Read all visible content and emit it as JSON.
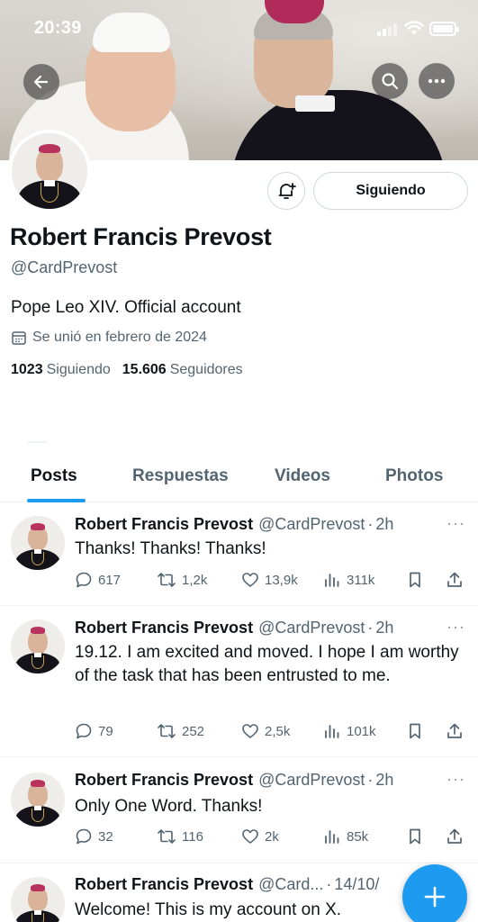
{
  "status_bar": {
    "time": "20:39"
  },
  "profile": {
    "display_name": "Robert Francis Prevost",
    "handle": "@CardPrevost",
    "bio": "Pope Leo XIV. Official account",
    "joined": "Se unió en febrero de 2024",
    "following_count": "1023",
    "following_label": "Siguiendo",
    "followers_count": "15.606",
    "followers_label": "Seguidores",
    "follow_button": "Siguiendo"
  },
  "tabs": [
    {
      "label": "Posts",
      "active": true
    },
    {
      "label": "Respuestas",
      "active": false
    },
    {
      "label": "Videos",
      "active": false
    },
    {
      "label": "Photos",
      "active": false
    }
  ],
  "posts": [
    {
      "name": "Robert Francis Prevost",
      "handle": "@CardPrevost",
      "separator": "·",
      "time": "2h",
      "text": "Thanks! Thanks! Thanks!",
      "replies": "617",
      "reposts": "1,2k",
      "likes": "13,9k",
      "views": "311k"
    },
    {
      "name": "Robert Francis Prevost",
      "handle": "@CardPrevost",
      "separator": "·",
      "time": "2h",
      "text": "19.12. I am excited and moved. I hope I am worthy of the task that has been entrusted to me.",
      "replies": "79",
      "reposts": "252",
      "likes": "2,5k",
      "views": "101k"
    },
    {
      "name": "Robert Francis Prevost",
      "handle": "@CardPrevost",
      "separator": "·",
      "time": "2h",
      "text": "Only One Word. Thanks!",
      "replies": "32",
      "reposts": "116",
      "likes": "2k",
      "views": "85k"
    },
    {
      "name": "Robert Francis Prevost",
      "handle": "@Card...",
      "separator": "·",
      "time": "14/10/",
      "text": "Welcome! This is my account on X."
    }
  ],
  "icons": {
    "back": "arrow-left-icon",
    "search": "search-icon",
    "more": "more-horizontal-icon",
    "notifications": "bell-plus-icon",
    "calendar": "calendar-icon",
    "reply": "reply-icon",
    "repost": "repost-icon",
    "like": "heart-icon",
    "views": "views-icon",
    "bookmark": "bookmark-icon",
    "share": "share-icon",
    "compose": "plus-icon"
  },
  "colors": {
    "accent": "#1d9bf0",
    "text_primary": "#0f1419",
    "text_secondary": "#536471",
    "divider": "#eff3f4"
  }
}
